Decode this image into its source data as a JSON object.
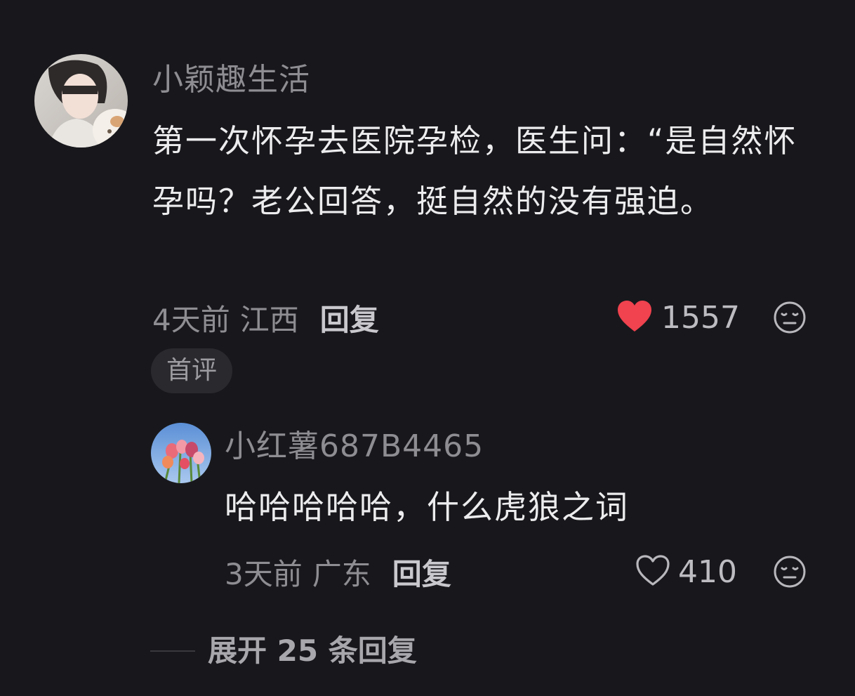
{
  "main_comment": {
    "username": "小颖趣生活",
    "text": "第一次怀孕去医院孕检，医生问：“是自然怀孕吗？老公回答，挺自然的没有强迫。",
    "time": "4天前",
    "location": "江西",
    "reply_label": "回复",
    "like_count": "1557",
    "liked": true,
    "badge": "首评"
  },
  "reply_comment": {
    "username": "小红薯687B4465",
    "text": "哈哈哈哈哈，什么虎狼之词",
    "time": "3天前",
    "location": "广东",
    "reply_label": "回复",
    "like_count": "410",
    "liked": false
  },
  "expand_label": "展开 25 条回复",
  "colors": {
    "background": "#18181c",
    "like_active": "#f0424f",
    "text_primary": "#ececee",
    "text_secondary": "#8e8e92"
  },
  "icons": {
    "like_active": "heart-filled-icon",
    "like": "heart-outline-icon",
    "dislike": "meh-face-icon"
  }
}
